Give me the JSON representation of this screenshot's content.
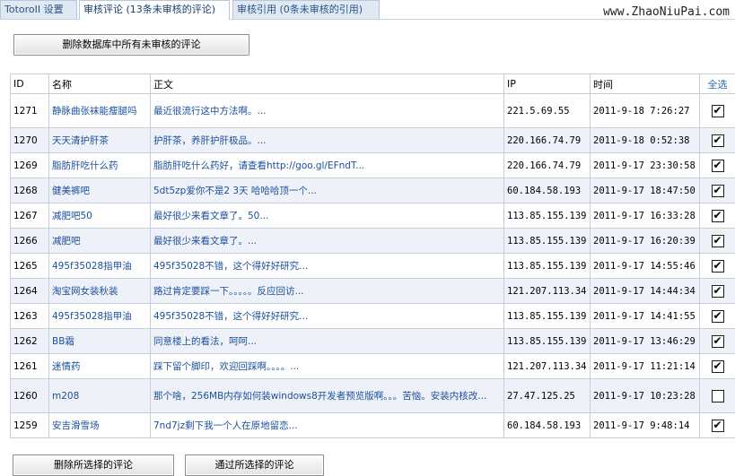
{
  "tabs": [
    {
      "label": "TotoroII 设置"
    },
    {
      "label": "审核评论 (13条未审核的评论)"
    },
    {
      "label": "审核引用 (0条未审核的引用)"
    }
  ],
  "site_label": "www.ZhaoNiuPai.com",
  "buttons": {
    "delete_all_unreviewed": "删除数据库中所有未审核的评论",
    "delete_selected": "删除所选择的评论",
    "approve_selected": "通过所选择的评论"
  },
  "table": {
    "headers": {
      "id": "ID",
      "name": "名称",
      "body": "正文",
      "ip": "IP",
      "time": "时间",
      "select_all": "全选"
    },
    "rows": [
      {
        "id": "1271",
        "name": "静脉曲张袜能瘦腿吗",
        "body": "最近很流行这中方法啊。...",
        "ip": "221.5.69.55",
        "time": "2011-9-18 7:26:27",
        "checked": true
      },
      {
        "id": "1270",
        "name": "天天清护肝茶",
        "body": "护肝茶，养肝护肝极品。...",
        "ip": "220.166.74.79",
        "time": "2011-9-18 0:52:38",
        "checked": true
      },
      {
        "id": "1269",
        "name": "脂肪肝吃什么药",
        "body": "脂肪肝吃什么药好，请查看http://goo.gl/EFndT...",
        "ip": "220.166.74.79",
        "time": "2011-9-17 23:30:58",
        "checked": true
      },
      {
        "id": "1268",
        "name": "健美裤吧",
        "body": "5dt5zp爱你不是2 3天 哈哈哈顶一个...",
        "ip": "60.184.58.193",
        "time": "2011-9-17 18:47:50",
        "checked": true
      },
      {
        "id": "1267",
        "name": "减肥吧50",
        "body": "最好很少来看文章了。50...",
        "ip": "113.85.155.139",
        "time": "2011-9-17 16:33:28",
        "checked": true
      },
      {
        "id": "1266",
        "name": "减肥吧",
        "body": "最好很少来看文章了。...",
        "ip": "113.85.155.139",
        "time": "2011-9-17 16:20:39",
        "checked": true
      },
      {
        "id": "1265",
        "name": "495f35028指甲油",
        "body": "495f35028不错，这个得好好研究...",
        "ip": "113.85.155.139",
        "time": "2011-9-17 14:55:46",
        "checked": true
      },
      {
        "id": "1264",
        "name": "淘宝网女装秋装",
        "body": "路过肯定要踩一下。。。。。反应回访...",
        "ip": "121.207.113.34",
        "time": "2011-9-17 14:44:34",
        "checked": true
      },
      {
        "id": "1263",
        "name": "495f35028指甲油",
        "body": "495f35028不错，这个得好好研究...",
        "ip": "113.85.155.139",
        "time": "2011-9-17 14:41:55",
        "checked": true
      },
      {
        "id": "1262",
        "name": "BB霜",
        "body": "同意楼上的看法，呵呵...",
        "ip": "113.85.155.139",
        "time": "2011-9-17 13:46:29",
        "checked": true
      },
      {
        "id": "1261",
        "name": "迷情药",
        "body": "踩下留个脚印，欢迎回踩啊。。。。...",
        "ip": "121.207.113.34",
        "time": "2011-9-17 11:21:14",
        "checked": true
      },
      {
        "id": "1260",
        "name": "m208",
        "body": "那个啥，256MB内存如何装windows8开发者预览版啊。。。苦恼。安装内核改...",
        "ip": "27.47.125.25",
        "time": "2011-9-17 10:23:28",
        "checked": false
      },
      {
        "id": "1259",
        "name": "安吉滑雪场",
        "body": "7nd7jz剩下我一个人在原地留恋...",
        "ip": "60.184.58.193",
        "time": "2011-9-17 9:48:14",
        "checked": true
      }
    ]
  },
  "colors": {
    "link": "#1a4f9c",
    "row_alt": "#eef2f8",
    "border": "#c5cfdc"
  }
}
